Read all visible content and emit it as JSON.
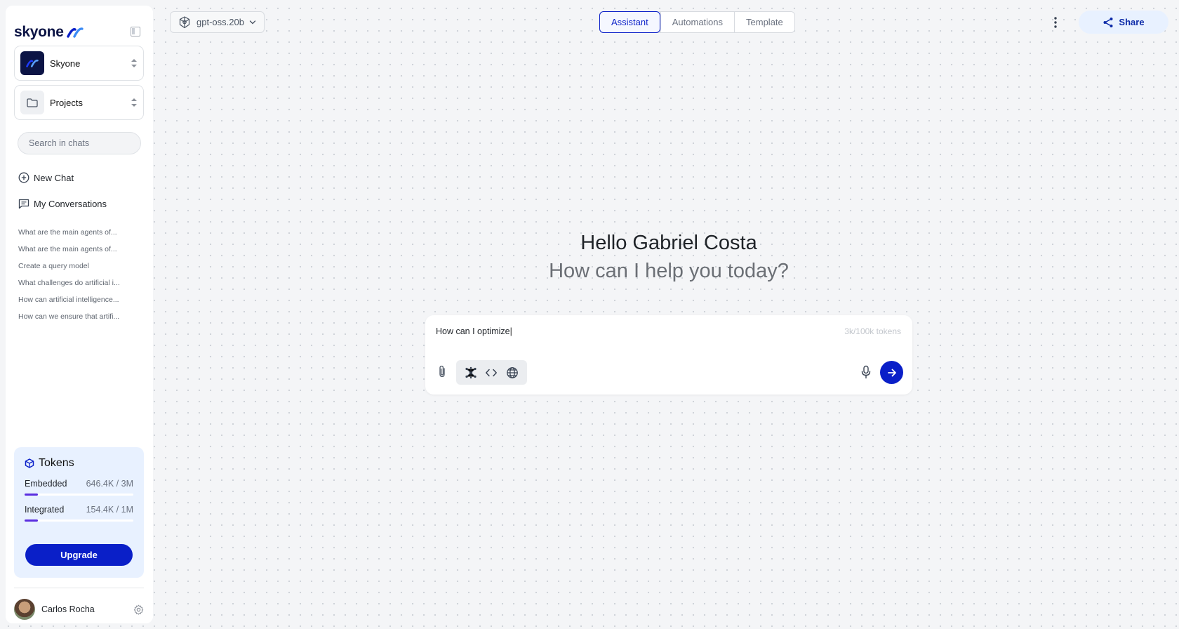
{
  "brand": {
    "name": "skyone",
    "accent": "#0a1fc8",
    "dark": "#0c1445"
  },
  "sidebar": {
    "workspace": {
      "label": "Skyone"
    },
    "projects": {
      "label": "Projects"
    },
    "search": {
      "placeholder": "Search in chats"
    },
    "new_chat": "New Chat",
    "conversations_title": "My Conversations",
    "history": [
      "What are the main agents of...",
      "What are the main agents of...",
      "Create a query model",
      "What challenges do artificial i...",
      "How can artificial intelligence...",
      "How can we ensure that artifi..."
    ],
    "tokens": {
      "title": "Tokens",
      "rows": [
        {
          "name": "Embedded",
          "value": "646.4K / 3M",
          "progress_percent": 12
        },
        {
          "name": "Integrated",
          "value": "154.4K / 1M",
          "progress_percent": 12
        }
      ],
      "upgrade_label": "Upgrade"
    },
    "user": {
      "name": "Carlos Rocha"
    }
  },
  "topbar": {
    "model": "gpt-oss.20b",
    "tabs": [
      {
        "label": "Assistant",
        "active": true
      },
      {
        "label": "Automations",
        "active": false
      },
      {
        "label": "Template",
        "active": false
      }
    ],
    "share_label": "Share"
  },
  "main": {
    "greeting": "Hello Gabriel Costa",
    "subtitle": "How can I help you today?",
    "composer": {
      "value": "How can I optimize",
      "token_count": "3k/100k tokens"
    }
  }
}
